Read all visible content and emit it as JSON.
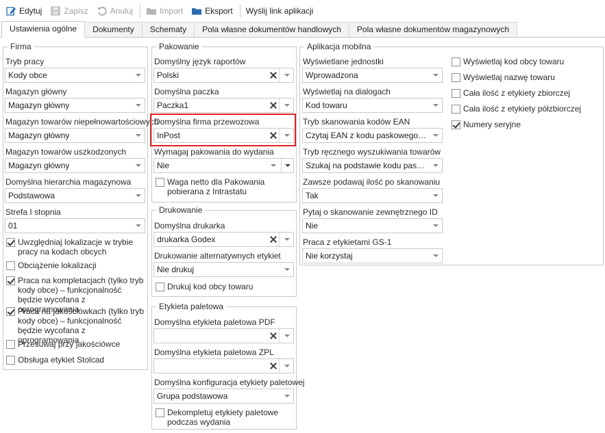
{
  "toolbar": {
    "edit": "Edytuj",
    "save": "Zapisz",
    "cancel": "Anuluj",
    "import": "Import",
    "export": "Eksport",
    "send_link": "Wyślij link aplikacji"
  },
  "tabs": [
    "Ustawienia ogólne",
    "Dokumenty",
    "Schematy",
    "Pola własne dokumentów handlowych",
    "Pola własne dokumentów magazynowych"
  ],
  "firma": {
    "title": "Firma",
    "tryb_pracy": {
      "label": "Tryb pracy",
      "value": "Kody obce"
    },
    "magazyn_glowny": {
      "label": "Magazyn główny",
      "value": "Magazyn główny"
    },
    "magazyn_niepelno": {
      "label": "Magazyn towarów niepełnowartościowych",
      "value": "Magazyn główny"
    },
    "magazyn_uszk": {
      "label": "Magazyn towarów uszkodzonych",
      "value": "Magazyn główny"
    },
    "hierarchia": {
      "label": "Domyślna hierarchia magazynowa",
      "value": "Podstawowa"
    },
    "strefa": {
      "label": "Strefa I stopnia",
      "value": "01"
    },
    "checkboxes": [
      {
        "label": "Uwzględniaj lokalizacje w trybie pracy na kodach obcych",
        "checked": true
      },
      {
        "label": "Obciążenie lokalizacji",
        "checked": false
      },
      {
        "label": "Praca na kompletacjach (tylko tryb kody obce) – funkcjonalność będzie wycofana z oprogramowania",
        "checked": true
      },
      {
        "label": "Praca na jakościówkach (tylko tryb kody obce) – funkcjonalność będzie wycofana z oprogramowania",
        "checked": true
      },
      {
        "label": "Przesuwaj przy jakościówce",
        "checked": false
      },
      {
        "label": "Obsługa etykiet Stolcad",
        "checked": false
      }
    ]
  },
  "pakowanie": {
    "title": "Pakowanie",
    "jezyk": {
      "label": "Domyślny język raportów",
      "value": "Polski"
    },
    "paczka": {
      "label": "Domyślna paczka",
      "value": "Paczka1"
    },
    "firma_przew": {
      "label": "Domyślna firma przewozowa",
      "value": "InPost"
    },
    "wymagaj": {
      "label": "Wymagaj pakowania do wydania",
      "value": "Nie"
    },
    "waga": {
      "label": "Waga netto dla Pakowania pobierana z Intrastatu",
      "checked": false
    }
  },
  "drukowanie": {
    "title": "Drukowanie",
    "drukarka": {
      "label": "Domyślna drukarka",
      "value": "drukarka Godex"
    },
    "alternatywne": {
      "label": "Drukowanie alternatywnych etykiet",
      "value": "Nie drukuj"
    },
    "kod_obcy": {
      "label": "Drukuj kod obcy towaru",
      "checked": false
    }
  },
  "etykieta": {
    "title": "Etykieta paletowa",
    "pdf": {
      "label": "Domyślna etykieta paletowa PDF",
      "value": ""
    },
    "zpl": {
      "label": "Domyślna etykieta paletowa ZPL",
      "value": ""
    },
    "konfig": {
      "label": "Domyślna konfiguracja etykiety paletowej",
      "value": "Grupa podstawowa"
    },
    "dekompletuj": {
      "label": "Dekompletuj etykiety paletowe podczas wydania",
      "checked": false
    }
  },
  "mobilna": {
    "title": "Aplikacja mobilna",
    "jednostki": {
      "label": "Wyświetlane jednostki",
      "value": "Wprowadzona"
    },
    "dialogi": {
      "label": "Wyświetlaj na dialogach",
      "value": "Kod towaru"
    },
    "ean": {
      "label": "Tryb skanowania kodów EAN",
      "value": "Czytaj EAN z kodu paskowego, kod..."
    },
    "reczny": {
      "label": "Tryb ręcznego wyszukiwania towarów",
      "value": "Szukaj na podstawie kodu paskowe..."
    },
    "ilosc": {
      "label": "Zawsze podawaj ilość po skanowaniu",
      "value": "Tak"
    },
    "zewn_id": {
      "label": "Pytaj o skanowanie zewnętrznego ID",
      "value": "Nie"
    },
    "gs1": {
      "label": "Praca z etykietami GS-1",
      "value": "Nie korzystaj"
    },
    "checkboxes": [
      {
        "label": "Wyświetlaj kod obcy towaru",
        "checked": false
      },
      {
        "label": "Wyświetlaj nazwę towaru",
        "checked": false
      },
      {
        "label": "Cała ilość z etykiety zbiorczej",
        "checked": false
      },
      {
        "label": "Cała ilość z etykiety półzbiorczej",
        "checked": false
      },
      {
        "label": "Numery seryjne",
        "checked": true
      }
    ]
  },
  "colors": {
    "highlight": "#e0211e",
    "accent": "#2b6cb0"
  }
}
